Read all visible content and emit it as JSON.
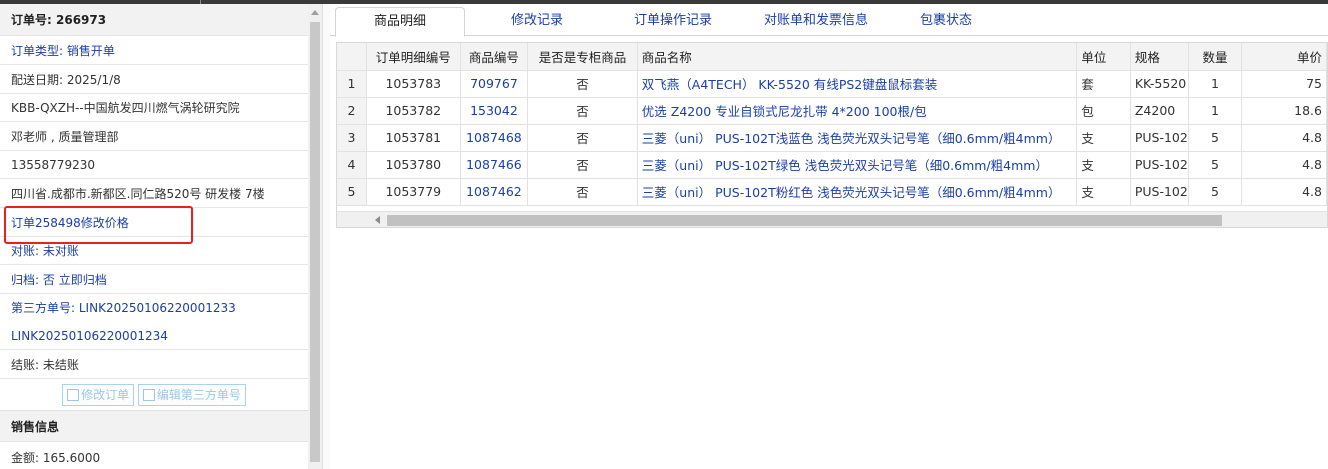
{
  "order": {
    "number_label": "订单号:",
    "number": "266973",
    "type_label": "订单类型:",
    "type": "销售开单",
    "delivery_label": "配送日期:",
    "delivery_date": "2025/1/8",
    "customer": "KBB-QXZH--中国航发四川燃气涡轮研究院",
    "contact": "邓老师 , 质量管理部",
    "phone": "13558779230",
    "address": "四川省.成都市.新都区.同仁路520号 研发楼 7楼",
    "note": "订单258498修改价格",
    "reconcile_label": "对账:",
    "reconcile": "未对账",
    "archive_label": "归档:",
    "archive": "否 立即归档",
    "third_party_label": "第三方单号:",
    "third_party_no": "LINK20250106220001233",
    "third_party_no2": "LINK20250106220001234",
    "settle_label": "结账:",
    "settle": "未结账",
    "edit_order_btn": "修改订单",
    "edit_third_btn": "编辑第三方单号",
    "sales_section": "销售信息",
    "amount_label": "金额:",
    "amount": "165.6000"
  },
  "tabs": [
    "商品明细",
    "修改记录",
    "订单操作记录",
    "对账单和发票信息",
    "包裹状态"
  ],
  "grid": {
    "columns": [
      "",
      "订单明细编号",
      "商品编号",
      "是否是专柜商品",
      "商品名称",
      "单位",
      "规格",
      "数量",
      "单价"
    ],
    "rows": [
      {
        "n": "1",
        "detail_id": "1053783",
        "sku": "709767",
        "counter": "否",
        "name": "双飞燕（A4TECH） KK-5520 有线PS2键盘鼠标套装",
        "unit": "套",
        "spec": "KK-5520",
        "qty": "1",
        "price": "75"
      },
      {
        "n": "2",
        "detail_id": "1053782",
        "sku": "153042",
        "counter": "否",
        "name": "优选 Z4200 专业自锁式尼龙扎带 4*200 100根/包",
        "unit": "包",
        "spec": "Z4200",
        "qty": "1",
        "price": "18.6"
      },
      {
        "n": "3",
        "detail_id": "1053781",
        "sku": "1087468",
        "counter": "否",
        "name": "三菱（uni） PUS-102T浅蓝色 浅色荧光双头记号笔（细0.6mm/粗4mm）",
        "unit": "支",
        "spec": "PUS-102",
        "qty": "5",
        "price": "4.8"
      },
      {
        "n": "4",
        "detail_id": "1053780",
        "sku": "1087466",
        "counter": "否",
        "name": "三菱（uni） PUS-102T绿色 浅色荧光双头记号笔（细0.6mm/粗4mm）",
        "unit": "支",
        "spec": "PUS-102",
        "qty": "5",
        "price": "4.8"
      },
      {
        "n": "5",
        "detail_id": "1053779",
        "sku": "1087462",
        "counter": "否",
        "name": "三菱（uni） PUS-102T粉红色 浅色荧光双头记号笔（细0.6mm/粗4mm）",
        "unit": "支",
        "spec": "PUS-102",
        "qty": "5",
        "price": "4.8"
      }
    ]
  },
  "colors": {
    "link": "#1a3fa6",
    "highlight_box": "#e8211e"
  }
}
